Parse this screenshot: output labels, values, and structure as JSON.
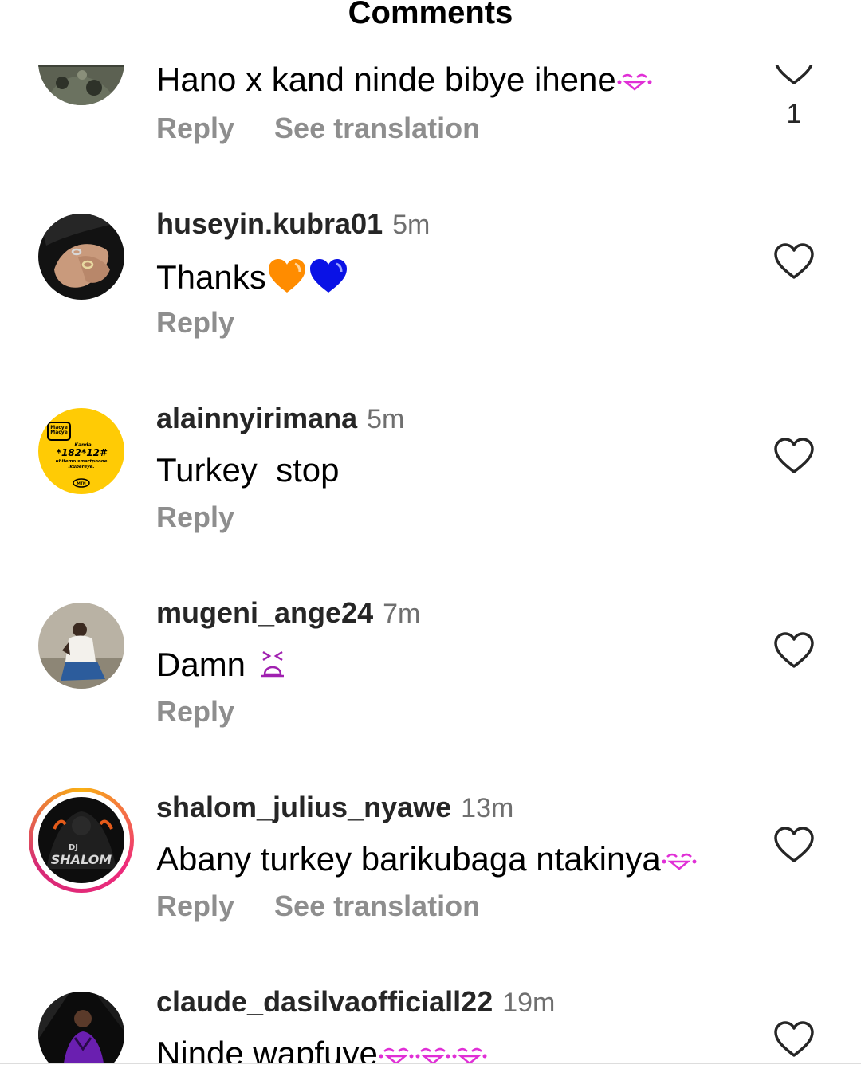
{
  "header": {
    "title": "Comments"
  },
  "comments": [
    {
      "text": "Hano x kand ninde bibye ihene",
      "reply_label": "Reply",
      "translate_label": "See translation",
      "like_count": "1"
    },
    {
      "username": "huseyin.kubra01",
      "time": "5m",
      "text": "Thanks",
      "reply_label": "Reply"
    },
    {
      "username": "alainnyirimana",
      "time": "5m",
      "text": "Turkey  stop",
      "reply_label": "Reply",
      "avatar_text": {
        "line1": "Macye",
        "line2": "Macye",
        "line3": "Kanda",
        "code": "*182*12#",
        "line4": "uhitemo smartphone",
        "line5": "ikubereye.",
        "brand": "MTN"
      }
    },
    {
      "username": "mugeni_ange24",
      "time": "7m",
      "text": "Damn ",
      "reply_label": "Reply"
    },
    {
      "username": "shalom_julius_nyawe",
      "time": "13m",
      "text": "Abany turkey barikubaga ntakinya",
      "reply_label": "Reply",
      "translate_label": "See translation",
      "avatar_text": {
        "line1": "DJ",
        "line2": "SHALOM"
      }
    },
    {
      "username": "claude_dasilvaofficiall22",
      "time": "19m",
      "text": "Ninde wapfuye"
    }
  ],
  "icons": {
    "like": "heart-outline-icon",
    "emoji_laugh": "laughing-tears-emoji",
    "emoji_orange_heart": "orange-heart-emoji",
    "emoji_blue_heart": "blue-heart-emoji",
    "emoji_tired": "tired-face-emoji"
  },
  "colors": {
    "text": "#000000",
    "username": "#262626",
    "muted": "#8e8e8e",
    "ring_start": "#f9b013",
    "ring_end": "#ee2a7b"
  }
}
